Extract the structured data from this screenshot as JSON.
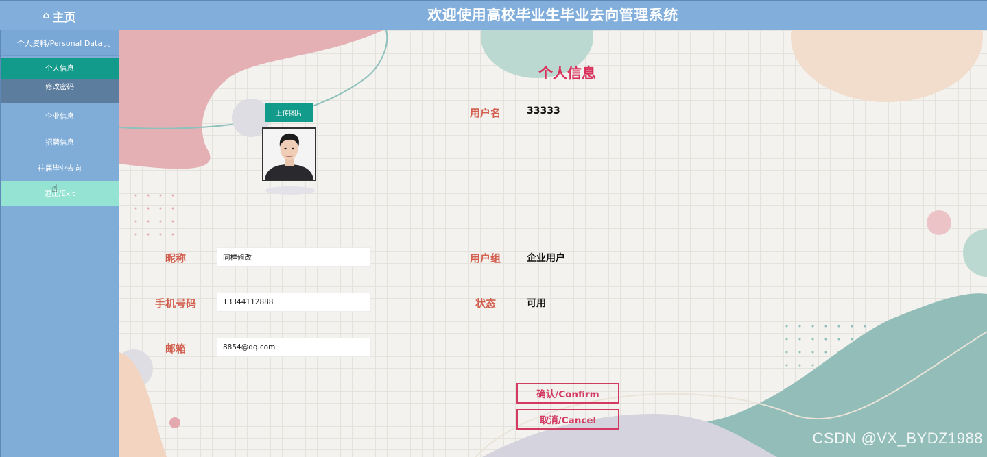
{
  "header": {
    "home_icon": "home-icon",
    "home_label": "主页",
    "app_title": "欢迎使用高校毕业生毕业去向管理系统"
  },
  "sidebar": {
    "group_label": "个人资料/Personal Data",
    "group_chevron": "chevron-up-icon",
    "items": [
      {
        "label": "个人信息",
        "active": true
      },
      {
        "label": "修改密码"
      },
      {
        "label": "企业信息"
      },
      {
        "label": "招聘信息"
      },
      {
        "label": "往届毕业去向"
      },
      {
        "label": "退出/Exit"
      }
    ]
  },
  "profile": {
    "title": "个人信息",
    "upload_label": "上传图片",
    "username_label": "用户名",
    "username_value": "33333",
    "nickname_label": "昵称",
    "nickname_value": "同样修改",
    "usergroup_label": "用户组",
    "usergroup_value": "企业用户",
    "phone_label": "手机号码",
    "phone_value": "13344112888",
    "status_label": "状态",
    "status_value": "可用",
    "email_label": "邮箱",
    "email_value": "8854@qq.com",
    "confirm_label": "确认/Confirm",
    "cancel_label": "取消/Cancel"
  },
  "watermark": "CSDN @VX_BYDZ1988",
  "colors": {
    "header_bg": "#82aedb",
    "sidebar_bg": "#7fadd8",
    "active_item": "#129a8a",
    "hover_item": "#94e3d3",
    "title_red": "#d8315b",
    "label_color": "#d25e4e",
    "button_border": "#d23a62"
  }
}
